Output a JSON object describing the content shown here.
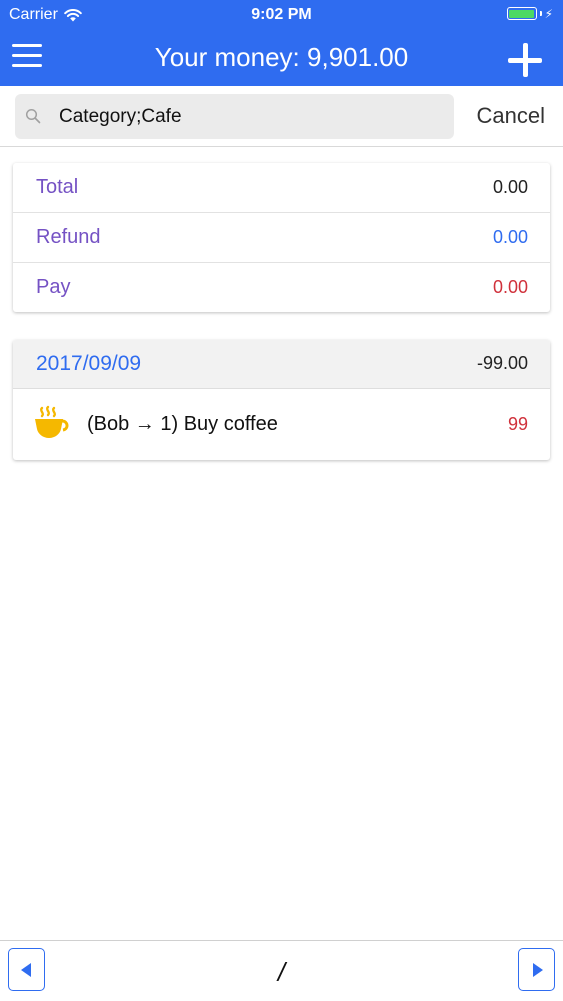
{
  "status_bar": {
    "carrier": "Carrier",
    "time": "9:02 PM",
    "battery_color": "#4cd964"
  },
  "nav": {
    "title": "Your money: 9,901.00",
    "left_icon": "menu-icon",
    "right_icon": "plus-icon",
    "background": "#2f6cf0"
  },
  "search": {
    "value": "Category;Cafe",
    "cancel_label": "Cancel",
    "icon": "search-icon"
  },
  "summary": {
    "rows": [
      {
        "label": "Total",
        "value": "0.00",
        "color": "#222222"
      },
      {
        "label": "Refund",
        "value": "0.00",
        "color": "#2f6cf0"
      },
      {
        "label": "Pay",
        "value": "0.00",
        "color": "#d0313b"
      }
    ],
    "label_color": "#7552c4"
  },
  "days": [
    {
      "date": "2017/09/09",
      "total": "-99.00",
      "transactions": [
        {
          "icon": "coffee-icon",
          "description": "(Bob → 1) Buy coffee",
          "amount": "99",
          "amount_color": "#d0313b"
        }
      ]
    }
  ],
  "pagination": {
    "indicator": "/",
    "prev_icon": "triangle-left-icon",
    "next_icon": "triangle-right-icon"
  }
}
